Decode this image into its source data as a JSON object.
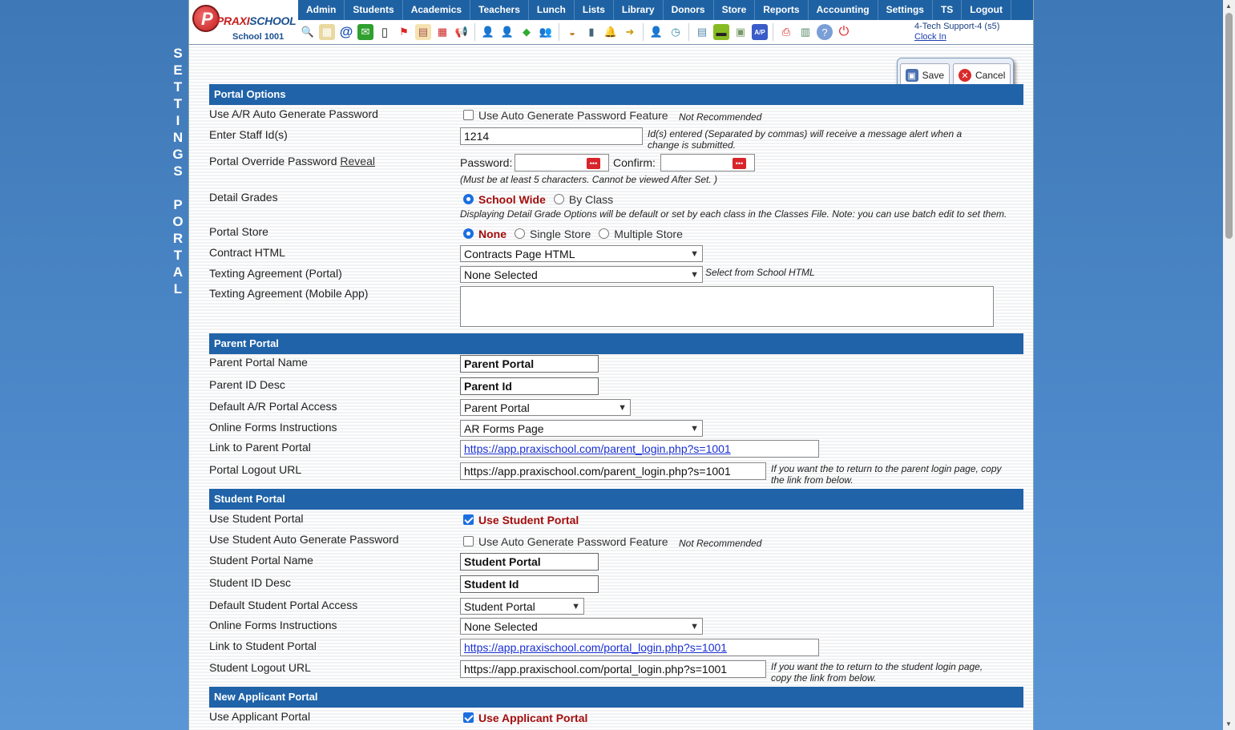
{
  "vertical_title": [
    "S",
    "E",
    "T",
    "T",
    "I",
    "N",
    "G",
    "S",
    " ",
    "P",
    "O",
    "R",
    "T",
    "A",
    "L"
  ],
  "logo": {
    "brand_prefix": "PRAXI",
    "brand_suffix": "SCHOOL",
    "school": "School 1001",
    "mark": "P"
  },
  "nav": [
    "Admin",
    "Students",
    "Academics",
    "Teachers",
    "Lunch",
    "Lists",
    "Library",
    "Donors",
    "Store",
    "Reports",
    "Accounting",
    "Settings",
    "TS",
    "Logout"
  ],
  "user": {
    "name": "4-Tech Support-4 (s5)",
    "clock": "Clock In"
  },
  "actions": {
    "save": "Save",
    "cancel": "Cancel"
  },
  "sections": {
    "portal_options": "Portal Options",
    "parent_portal": "Parent Portal",
    "student_portal": "Student Portal",
    "applicant_portal": "New Applicant Portal"
  },
  "portal_options": {
    "auto_pw_label": "Use A/R Auto Generate Password",
    "auto_pw_option": "Use Auto Generate Password Feature",
    "auto_pw_note": "Not Recommended",
    "staff_label": "Enter Staff Id(s)",
    "staff_value": "1214",
    "staff_note": "Id(s) entered (Separated by commas) will receive a message alert when a change is submitted.",
    "override_label": "Portal Override Password",
    "override_link": "Reveal",
    "password_label": "Password:",
    "confirm_label": "Confirm:",
    "password_note": "(Must be at least 5 characters. Cannot be viewed After Set. )",
    "detail_label": "Detail Grades",
    "detail_opt1": "School Wide",
    "detail_opt2": "By Class",
    "detail_note": "Displaying Detail Grade Options will be default or set by each class in the Classes File. Note: you can use batch edit to set them.",
    "store_label": "Portal Store",
    "store_opt1": "None",
    "store_opt2": "Single Store",
    "store_opt3": "Multiple Store",
    "contract_label": "Contract HTML",
    "contract_value": "Contracts Page HTML",
    "texting_portal_label": "Texting Agreement (Portal)",
    "texting_portal_value": "None Selected",
    "texting_portal_note": "Select from School HTML",
    "texting_app_label": "Texting Agreement (Mobile App)"
  },
  "parent_portal": {
    "name_label": "Parent Portal Name",
    "name_value": "Parent Portal",
    "id_label": "Parent ID Desc",
    "id_value": "Parent Id",
    "access_label": "Default A/R Portal Access",
    "access_value": "Parent Portal",
    "forms_label": "Online Forms Instructions",
    "forms_value": "AR Forms Page",
    "link_label": "Link to Parent Portal",
    "link_value": "https://app.praxischool.com/parent_login.php?s=1001",
    "logout_label": "Portal Logout URL",
    "logout_value": "https://app.praxischool.com/parent_login.php?s=1001",
    "logout_note": "If you want the to return to the parent login page, copy the link from below."
  },
  "student_portal": {
    "use_label": "Use Student Portal",
    "use_option": "Use Student Portal",
    "auto_pw_label": "Use Student Auto Generate Password",
    "auto_pw_option": "Use Auto Generate Password Feature",
    "auto_pw_note": "Not Recommended",
    "name_label": "Student Portal Name",
    "name_value": "Student Portal",
    "id_label": "Student ID Desc",
    "id_value": "Student Id",
    "access_label": "Default Student Portal Access",
    "access_value": "Student Portal",
    "forms_label": "Online Forms Instructions",
    "forms_value": "None Selected",
    "link_label": "Link to Student Portal",
    "link_value": "https://app.praxischool.com/portal_login.php?s=1001",
    "logout_label": "Student Logout URL",
    "logout_value": "https://app.praxischool.com/portal_login.php?s=1001",
    "logout_note": "If you want the to return to the student login page, copy the link from below."
  },
  "applicant_portal": {
    "use_label": "Use Applicant Portal",
    "use_option": "Use Applicant Portal"
  }
}
